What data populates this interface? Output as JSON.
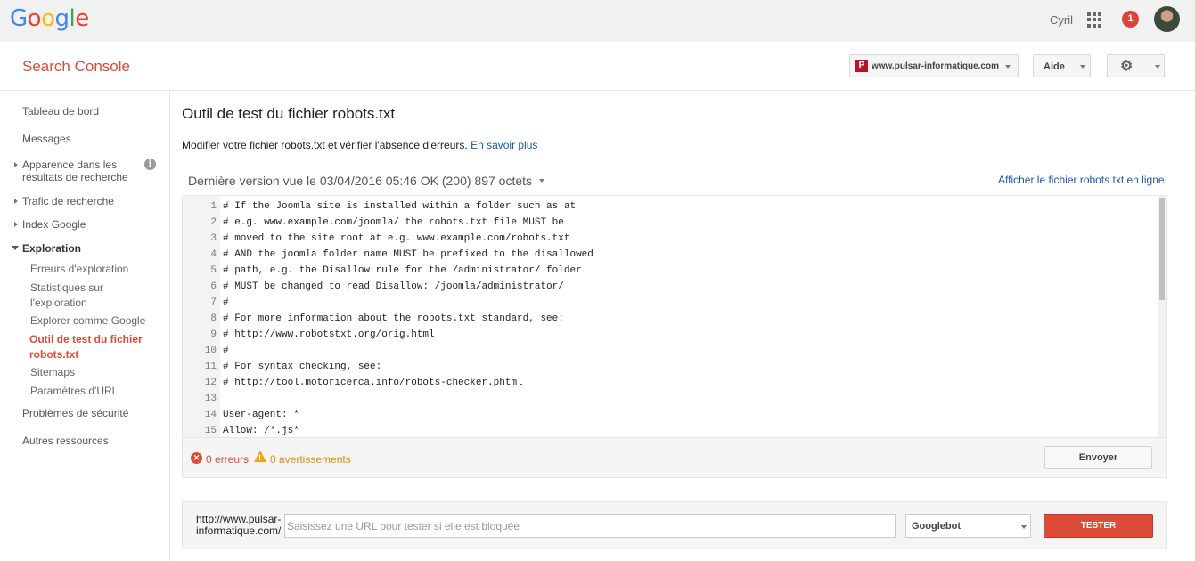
{
  "topbar": {
    "logo": [
      "G",
      "o",
      "o",
      "g",
      "l",
      "e"
    ],
    "user_name": "Cyril",
    "notifications": "1"
  },
  "header": {
    "app_title": "Search Console",
    "site": "www.pulsar-informatique.com",
    "site_favicon": "P",
    "help_label": "Aide",
    "settings_icon": "gear-icon"
  },
  "sidebar": {
    "dashboard": "Tableau de bord",
    "messages": "Messages",
    "appearance": "Apparence dans les résultats de recherche",
    "traffic": "Trafic de recherche",
    "index": "Index Google",
    "crawl": "Exploration",
    "crawl_errors": "Erreurs d'exploration",
    "crawl_stats": "Statistiques sur l'exploration",
    "fetch_as_google": "Explorer comme Google",
    "robots_tester": "Outil de test du fichier robots.txt",
    "sitemaps": "Sitemaps",
    "url_params": "Paramètres d'URL",
    "security": "Problèmes de sécurité",
    "other_resources": "Autres ressources"
  },
  "main": {
    "title": "Outil de test du fichier robots.txt",
    "intro": "Modifier votre fichier robots.txt et vérifier l'absence d'erreurs.",
    "learn_more": "En savoir plus",
    "version_label": "Dernière version vue le 03/04/2016 05:46 OK (200) 897 octets",
    "view_live": "Afficher le fichier robots.txt en ligne"
  },
  "editor": {
    "lines": [
      {
        "n": "1",
        "text": "# If the Joomla site is installed within a folder such as at"
      },
      {
        "n": "2",
        "text": "# e.g. www.example.com/joomla/ the robots.txt file MUST be"
      },
      {
        "n": "3",
        "text": "# moved to the site root at e.g. www.example.com/robots.txt"
      },
      {
        "n": "4",
        "text": "# AND the joomla folder name MUST be prefixed to the disallowed"
      },
      {
        "n": "5",
        "text": "# path, e.g. the Disallow rule for the /administrator/ folder"
      },
      {
        "n": "6",
        "text": "# MUST be changed to read Disallow: /joomla/administrator/"
      },
      {
        "n": "7",
        "text": "#"
      },
      {
        "n": "8",
        "text": "# For more information about the robots.txt standard, see:"
      },
      {
        "n": "9",
        "text": "# http://www.robotstxt.org/orig.html"
      },
      {
        "n": "10",
        "text": "#"
      },
      {
        "n": "11",
        "text": "# For syntax checking, see:"
      },
      {
        "n": "12",
        "text": "# http://tool.motoricerca.info/robots-checker.phtml"
      },
      {
        "n": "13",
        "text": ""
      },
      {
        "n": "14",
        "text": "User-agent: *"
      },
      {
        "n": "15",
        "text": "Allow: /*.js*"
      }
    ],
    "errors": "0 erreurs",
    "warnings": "0 avertissements",
    "submit_label": "Envoyer"
  },
  "tester": {
    "prefix_line1": "http://www.pulsar-",
    "prefix_line2": "informatique.com/",
    "placeholder": "Saisissez une URL pour tester si elle est bloquée",
    "bot": "Googlebot",
    "test_label": "TESTER"
  },
  "colors": {
    "accent_red": "#dd4b39",
    "link_blue": "#1a5aaa",
    "warning_orange": "#f4a20d"
  }
}
